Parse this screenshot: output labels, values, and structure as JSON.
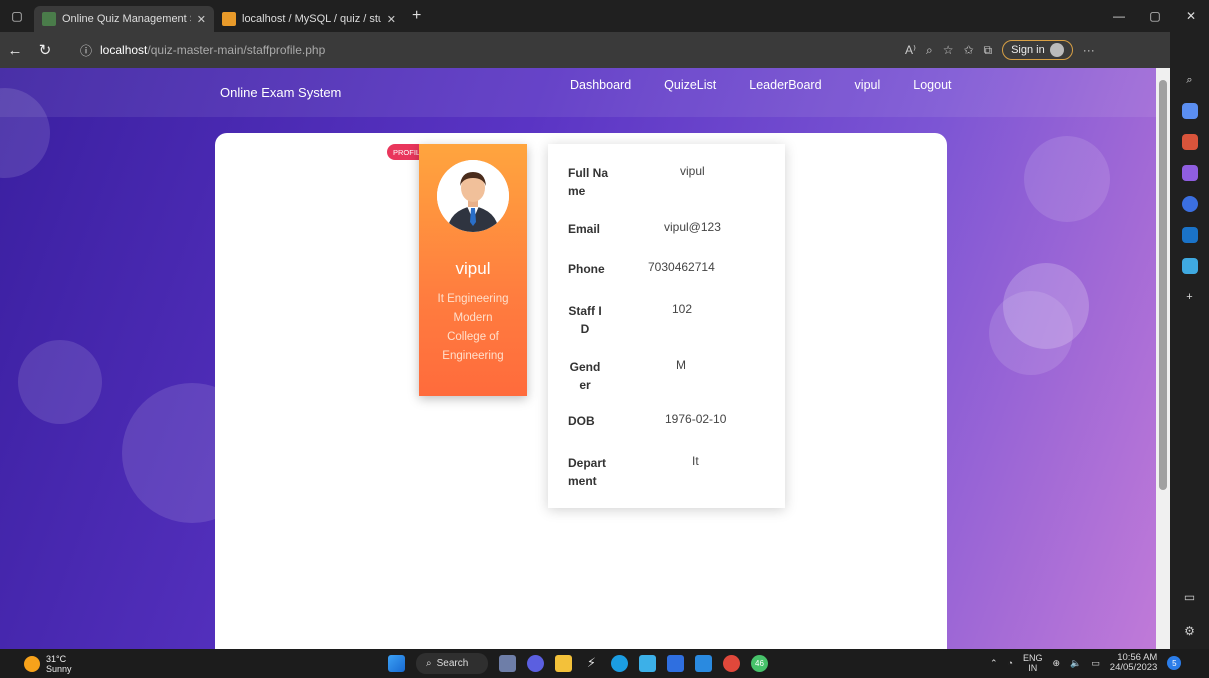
{
  "browser": {
    "tabs": [
      {
        "title": "Online Quiz Management Systen",
        "active": true
      },
      {
        "title": "localhost / MySQL / quiz / stude",
        "active": false
      }
    ],
    "url_host": "localhost",
    "url_path": "/quiz-master-main/staffprofile.php",
    "sign_in_label": "Sign in",
    "win_controls": {
      "minimize": "—",
      "restore": "▢",
      "close": "✕"
    }
  },
  "site": {
    "brand": "Online Exam System",
    "nav": [
      "Dashboard",
      "QuizeList",
      "LeaderBoard",
      "vipul",
      "Logout"
    ]
  },
  "profile": {
    "badge": "PROFILE",
    "name": "vipul",
    "dept_lines": [
      "It Engineering",
      "Modern",
      "College of",
      "Engineering"
    ],
    "fields": [
      {
        "label": "Full Name",
        "value": "vipul"
      },
      {
        "label": "Email",
        "value": "vipul@123"
      },
      {
        "label": "Phone",
        "value": "7030462714"
      },
      {
        "label": "Staff ID",
        "value": "102"
      },
      {
        "label": "Gender",
        "value": "M"
      },
      {
        "label": "DOB",
        "value": "1976-02-10"
      },
      {
        "label": "Department",
        "value": "It"
      }
    ]
  },
  "taskbar": {
    "temperature": "31°C",
    "condition": "Sunny",
    "search_label": "Search",
    "lang": "ENG",
    "region": "IN",
    "time": "10:56 AM",
    "date": "24/05/2023",
    "chrome_badge": "46"
  },
  "colors": {
    "accent_orange": "#ff7d3f",
    "badge_pink": "#e9365c",
    "bg_purple": "#5a34c4"
  }
}
